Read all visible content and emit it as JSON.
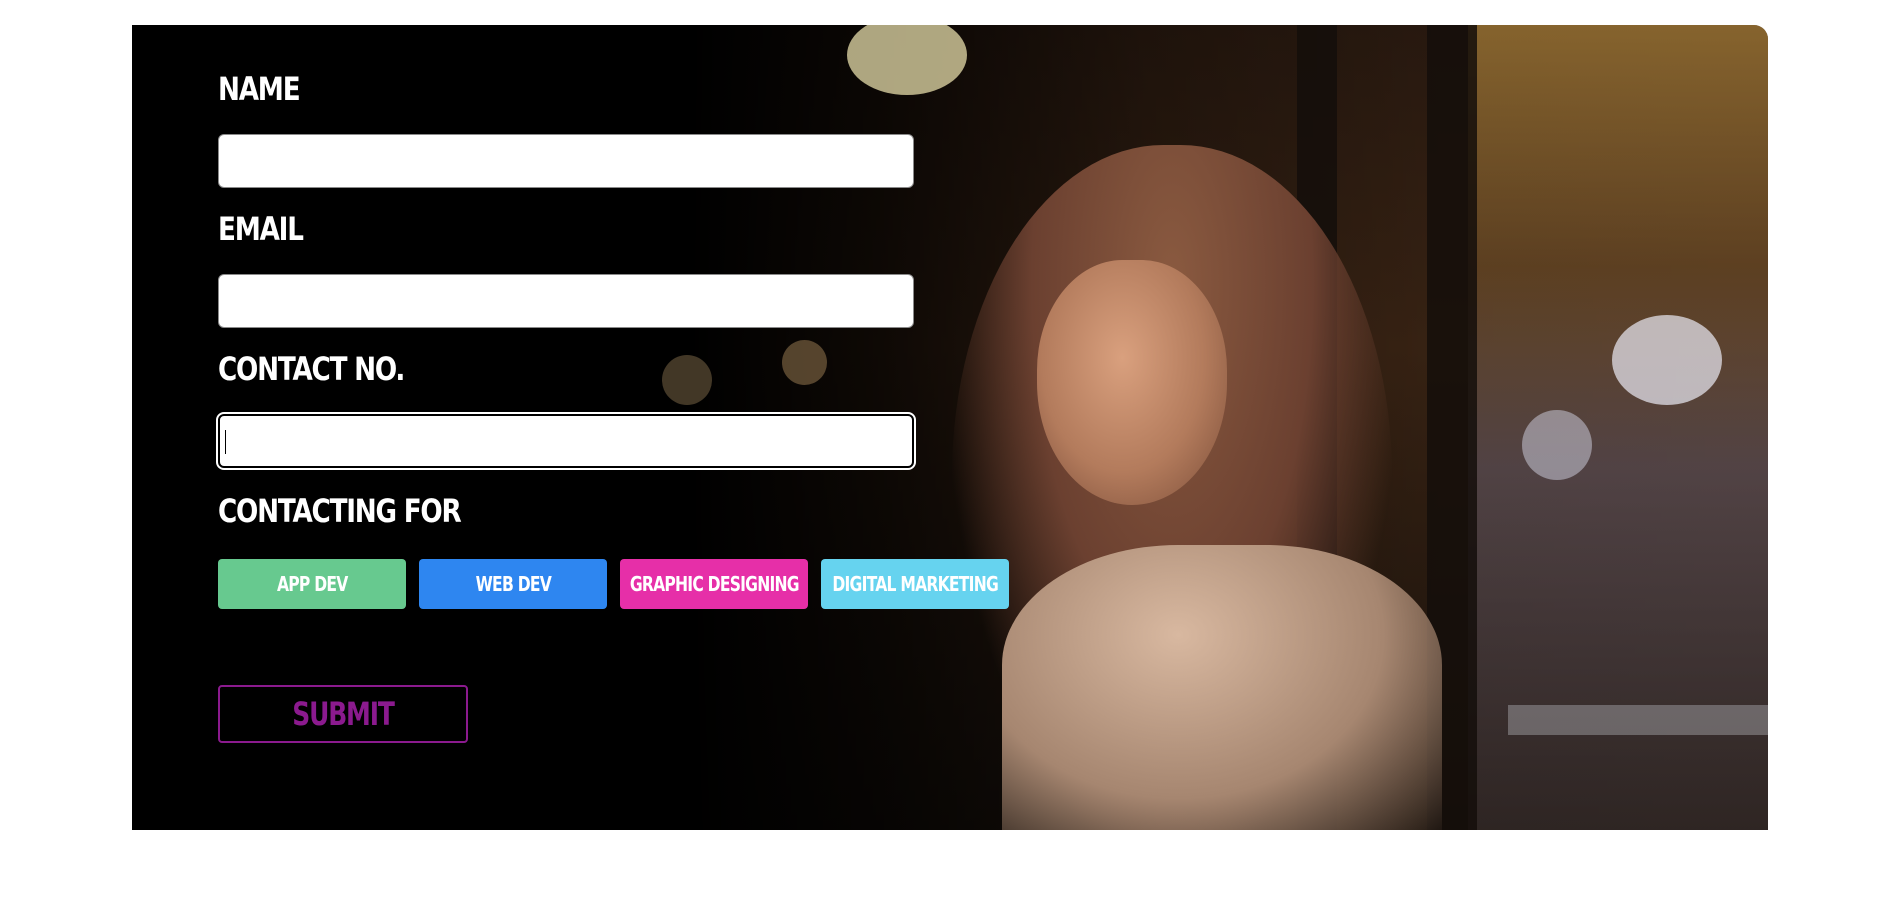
{
  "form": {
    "name_label": "NAME",
    "email_label": "EMAIL",
    "contact_label": "CONTACT NO.",
    "contacting_for_label": "CONTACTING FOR",
    "name_value": "",
    "email_value": "",
    "contact_value": ""
  },
  "options": [
    {
      "label": "APP DEV",
      "color": "#67c98f"
    },
    {
      "label": "WEB DEV",
      "color": "#2e86f0"
    },
    {
      "label": "GRAPHIC DESIGNING",
      "color": "#e62fa8"
    },
    {
      "label": "DIGITAL MARKETING",
      "color": "#66d3ef"
    }
  ],
  "submit_label": "SUBMIT",
  "colors": {
    "submit_accent": "#8b1a8e",
    "hero_overlay": "#000000"
  }
}
